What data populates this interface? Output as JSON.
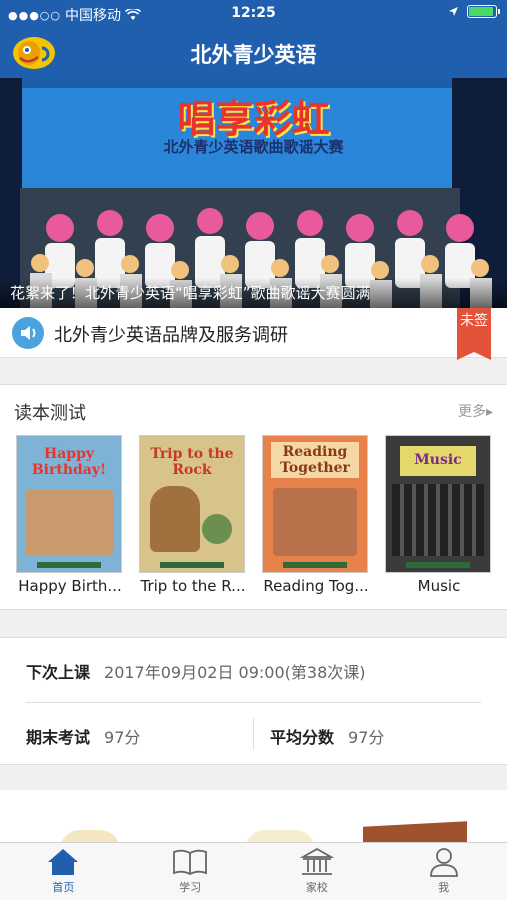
{
  "status_bar": {
    "carrier": "中国移动",
    "time": "12:25"
  },
  "nav": {
    "title": "北外青少英语"
  },
  "banner": {
    "stage_title": "唱享彩虹",
    "stage_subtitle": "北外青少英语歌曲歌谣大赛",
    "caption": "花絮来了！北外青少英语“唱享彩虹”歌曲歌谣大赛圆满"
  },
  "notice": {
    "text": "北外青少英语品牌及服务调研",
    "tag": "未签"
  },
  "books": {
    "heading": "读本测试",
    "more": "更多▸",
    "items": [
      {
        "name": "Happy Birth...",
        "cover_title": "Happy Birthday!",
        "color": "#7fb3d5"
      },
      {
        "name": "Trip to the R...",
        "cover_title": "Trip to the Rock",
        "color": "#d8c48a"
      },
      {
        "name": "Reading Tog...",
        "cover_title": "Reading Together",
        "color": "#e9824a"
      },
      {
        "name": "Music",
        "cover_title": "Music",
        "color": "#3b3b3b"
      }
    ]
  },
  "schedule": {
    "next_label": "下次上课",
    "next_value": "2017年09月02日 09:00(第38次课)",
    "final_label": "期末考试",
    "final_value": "97分",
    "avg_label": "平均分数",
    "avg_value": "97分"
  },
  "tabs": [
    {
      "label": "首页",
      "icon": "home-icon",
      "active": true
    },
    {
      "label": "学习",
      "icon": "book-icon",
      "active": false
    },
    {
      "label": "家校",
      "icon": "school-icon",
      "active": false
    },
    {
      "label": "我",
      "icon": "person-icon",
      "active": false
    }
  ],
  "colors": {
    "brand": "#1f5fae",
    "tag": "#e3533a"
  }
}
